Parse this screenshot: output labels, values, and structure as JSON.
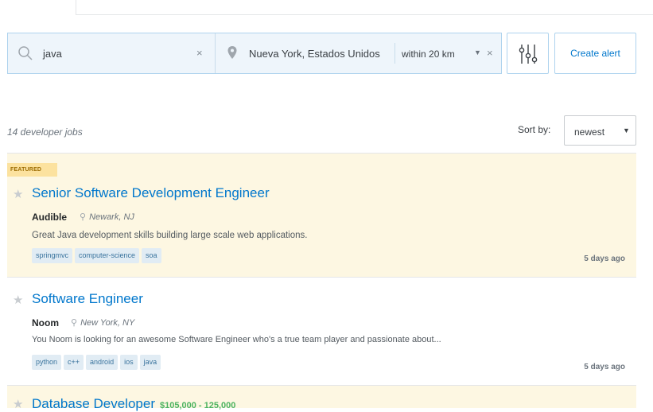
{
  "search": {
    "keyword": "java",
    "location": "Nueva York, Estados Unidos",
    "within": "within 20 km",
    "clear_symbol": "×",
    "caret_symbol": "▼"
  },
  "actions": {
    "create_alert_label": "Create alert"
  },
  "results": {
    "count_label": "14 developer jobs",
    "sort_label": "Sort by:",
    "sort_value": "newest"
  },
  "jobs": [
    {
      "featured_label": "FEATURED",
      "title": "Senior Software Development Engineer",
      "company": "Audible",
      "location": "Newark, NJ",
      "description": "Great Java development skills building large scale web applications.",
      "tags": [
        "springmvc",
        "computer-science",
        "soa"
      ],
      "posted": "5 days ago"
    },
    {
      "title": "Software Engineer",
      "company": "Noom",
      "location": "New York, NY",
      "description": "You Noom is looking for an awesome Software Engineer who's a true team player and passionate about...",
      "tags": [
        "python",
        "c++",
        "android",
        "ios",
        "java"
      ],
      "posted": "5 days ago"
    },
    {
      "title": "Database Developer",
      "salary": "$105,000 - 125,000"
    }
  ],
  "icons": {
    "star": "★",
    "pin": "⚲"
  },
  "colors": {
    "link_blue": "#0077cc",
    "featured_bg": "#fdf7e2",
    "featured_badge": "#fce29f",
    "tag_bg": "#e1ecf4",
    "tag_text": "#39739d",
    "salary_green": "#4cb361"
  }
}
